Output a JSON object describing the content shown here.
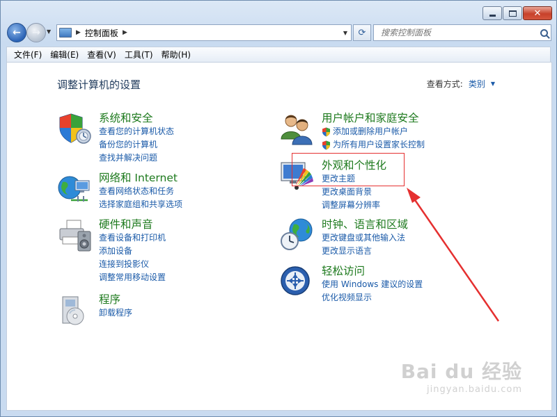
{
  "window": {
    "caption_buttons": [
      "minimize",
      "maximize",
      "close"
    ]
  },
  "nav": {
    "address_crumb": "控制面板",
    "search_placeholder": "搜索控制面板"
  },
  "menu": [
    "文件(F)",
    "编辑(E)",
    "查看(V)",
    "工具(T)",
    "帮助(H)"
  ],
  "page": {
    "title": "调整计算机的设置",
    "view_by_label": "查看方式:",
    "view_by_value": "类别"
  },
  "categories_left": [
    {
      "icon": "shield-icon",
      "title": "系统和安全",
      "links": [
        "查看您的计算机状态",
        "备份您的计算机",
        "查找并解决问题"
      ]
    },
    {
      "icon": "globe-network-icon",
      "title": "网络和 Internet",
      "links": [
        "查看网络状态和任务",
        "选择家庭组和共享选项"
      ]
    },
    {
      "icon": "printer-icon",
      "title": "硬件和声音",
      "links": [
        "查看设备和打印机",
        "添加设备",
        "连接到投影仪",
        "调整常用移动设置"
      ]
    },
    {
      "icon": "programs-icon",
      "title": "程序",
      "links": [
        "卸载程序"
      ]
    }
  ],
  "categories_right": [
    {
      "icon": "users-icon",
      "title": "用户帐户和家庭安全",
      "links": [
        "添加或删除用户帐户",
        "为所有用户设置家长控制"
      ]
    },
    {
      "icon": "appearance-icon",
      "title": "外观和个性化",
      "links": [
        "更改主题",
        "更改桌面背景",
        "调整屏幕分辨率"
      ]
    },
    {
      "icon": "clock-globe-icon",
      "title": "时钟、语言和区域",
      "links": [
        "更改键盘或其他输入法",
        "更改显示语言"
      ]
    },
    {
      "icon": "ease-of-access-icon",
      "title": "轻松访问",
      "links": [
        "使用 Windows 建议的设置",
        "优化视频显示"
      ]
    }
  ],
  "watermark": {
    "line1": "Bai du 经验",
    "line2": "jingyan.baidu.com"
  },
  "colors": {
    "category_title": "#1e7a1e",
    "link": "#1a5aa8",
    "highlight": "#e53030"
  }
}
